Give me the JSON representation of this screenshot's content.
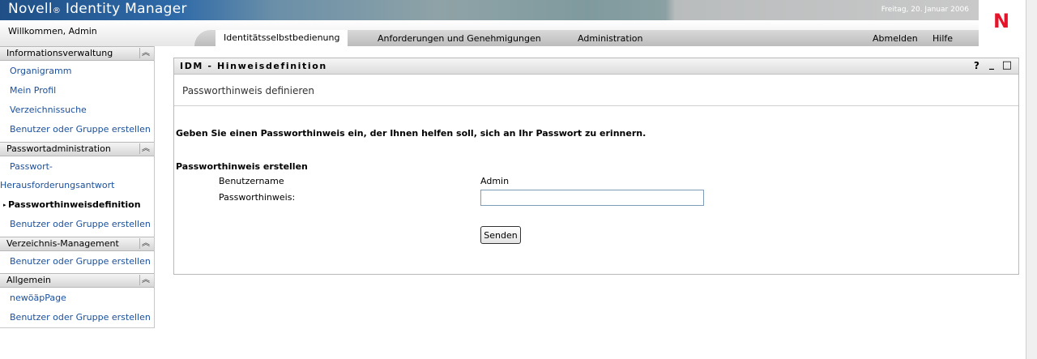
{
  "header": {
    "brand_name": "Novell",
    "brand_reg": "®",
    "brand_product": " Identity Manager",
    "date": "Freitag, 20. Januar 2006",
    "logo": "N",
    "welcome": "Willkommen, Admin"
  },
  "tabs": [
    {
      "label": "Identitätsselbstbedienung",
      "active": true
    },
    {
      "label": "Anforderungen und Genehmigungen"
    },
    {
      "label": "Administration"
    }
  ],
  "links": {
    "logout": "Abmelden",
    "help": "Hilfe"
  },
  "sidebar": {
    "sections": [
      {
        "title": "Informationsverwaltung",
        "items": [
          "Organigramm",
          "Mein Profil",
          "Verzeichnissuche",
          "Benutzer oder Gruppe erstellen"
        ]
      },
      {
        "title": "Passwortadministration",
        "items": [
          "Passwort-",
          "Herausforderungsantwort",
          "Passworthinweisdefinition",
          "Benutzer oder Gruppe erstellen"
        ]
      },
      {
        "title": "Verzeichnis-Management",
        "items": [
          "Benutzer oder Gruppe erstellen"
        ]
      },
      {
        "title": "Allgemein",
        "items": [
          "newöäpPage",
          "Benutzer oder Gruppe erstellen"
        ]
      }
    ]
  },
  "portlet": {
    "title": "IDM - Hinweisdefinition",
    "help": "?",
    "minimize": "_",
    "maximize": "□",
    "heading": "Passworthinweis definieren",
    "instructions": "Geben Sie einen Passworthinweis ein, der Ihnen helfen soll, sich an Ihr Passwort zu erinnern.",
    "subheading": "Passworthinweis erstellen",
    "username_label": "Benutzername",
    "username_value": "Admin",
    "hint_label": "Passworthinweis:",
    "hint_value": "",
    "submit_label": "Senden"
  }
}
